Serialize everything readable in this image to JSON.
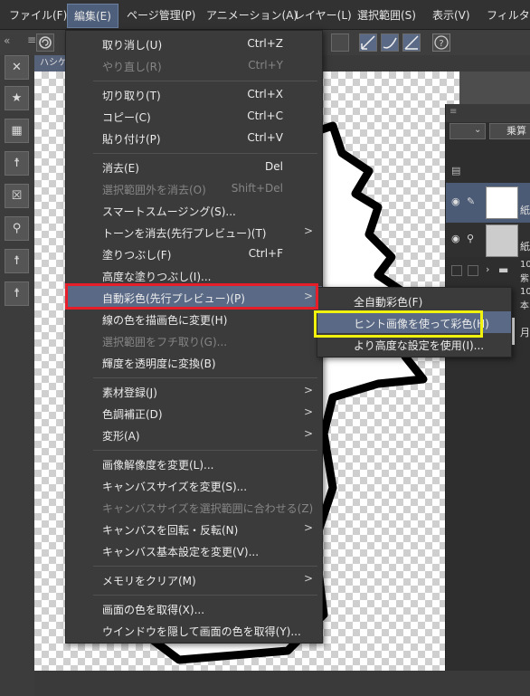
{
  "menubar": {
    "items": [
      "ファイル(F)",
      "編集(E)",
      "ページ管理(P)",
      "アニメーション(A)",
      "レイヤー(L)",
      "選択範囲(S)",
      "表示(V)",
      "フィルター("
    ]
  },
  "document_tab": {
    "label": "ハシケン"
  },
  "layer_panel": {
    "blend_mode": "乗算",
    "rows": [
      "紙",
      "紙",
      "10",
      "紫",
      "10",
      "本",
      "月"
    ]
  },
  "edit_menu": {
    "items": [
      {
        "label": "取り消し(U)",
        "shortcut": "Ctrl+Z",
        "enabled": true
      },
      {
        "label": "やり直し(R)",
        "shortcut": "Ctrl+Y",
        "enabled": false
      },
      {
        "label": "切り取り(T)",
        "shortcut": "Ctrl+X",
        "enabled": true
      },
      {
        "label": "コピー(C)",
        "shortcut": "Ctrl+C",
        "enabled": true
      },
      {
        "label": "貼り付け(P)",
        "shortcut": "Ctrl+V",
        "enabled": true
      },
      {
        "label": "消去(E)",
        "shortcut": "Del",
        "enabled": true
      },
      {
        "label": "選択範囲外を消去(O)",
        "shortcut": "Shift+Del",
        "enabled": false
      },
      {
        "label": "スマートスムージング(S)...",
        "shortcut": "",
        "enabled": true
      },
      {
        "label": "トーンを消去(先行プレビュー)(T)",
        "shortcut": "",
        "enabled": true,
        "submenu": true
      },
      {
        "label": "塗りつぶし(F)",
        "shortcut": "Ctrl+F",
        "enabled": true
      },
      {
        "label": "高度な塗りつぶし(I)...",
        "shortcut": "",
        "enabled": true
      },
      {
        "label": "自動彩色(先行プレビュー)(P)",
        "shortcut": "",
        "enabled": true,
        "submenu": true,
        "highlighted": true
      },
      {
        "label": "線の色を描画色に変更(H)",
        "shortcut": "",
        "enabled": true
      },
      {
        "label": "選択範囲をフチ取り(G)...",
        "shortcut": "",
        "enabled": false
      },
      {
        "label": "輝度を透明度に変換(B)",
        "shortcut": "",
        "enabled": true
      },
      {
        "label": "素材登録(J)",
        "shortcut": "",
        "enabled": true,
        "submenu": true
      },
      {
        "label": "色調補正(D)",
        "shortcut": "",
        "enabled": true,
        "submenu": true
      },
      {
        "label": "変形(A)",
        "shortcut": "",
        "enabled": true,
        "submenu": true
      },
      {
        "label": "画像解像度を変更(L)...",
        "shortcut": "",
        "enabled": true
      },
      {
        "label": "キャンバスサイズを変更(S)...",
        "shortcut": "",
        "enabled": true
      },
      {
        "label": "キャンバスサイズを選択範囲に合わせる(Z)",
        "shortcut": "",
        "enabled": false
      },
      {
        "label": "キャンバスを回転・反転(N)",
        "shortcut": "",
        "enabled": true,
        "submenu": true
      },
      {
        "label": "キャンバス基本設定を変更(V)...",
        "shortcut": "",
        "enabled": true
      },
      {
        "label": "メモリをクリア(M)",
        "shortcut": "",
        "enabled": true,
        "submenu": true
      },
      {
        "label": "画面の色を取得(X)...",
        "shortcut": "",
        "enabled": true
      },
      {
        "label": "ウインドウを隠して画面の色を取得(Y)...",
        "shortcut": "",
        "enabled": true
      }
    ]
  },
  "auto_color_submenu": {
    "items": [
      {
        "label": "全自動彩色(F)",
        "highlighted": false
      },
      {
        "label": "ヒント画像を使って彩色(H)",
        "highlighted": true
      },
      {
        "label": "より高度な設定を使用(I)...",
        "highlighted": false
      }
    ]
  },
  "colors": {
    "highlight": "#5a6a86",
    "callout_red": "#e51e2a",
    "callout_yellow": "#f2f20f"
  }
}
